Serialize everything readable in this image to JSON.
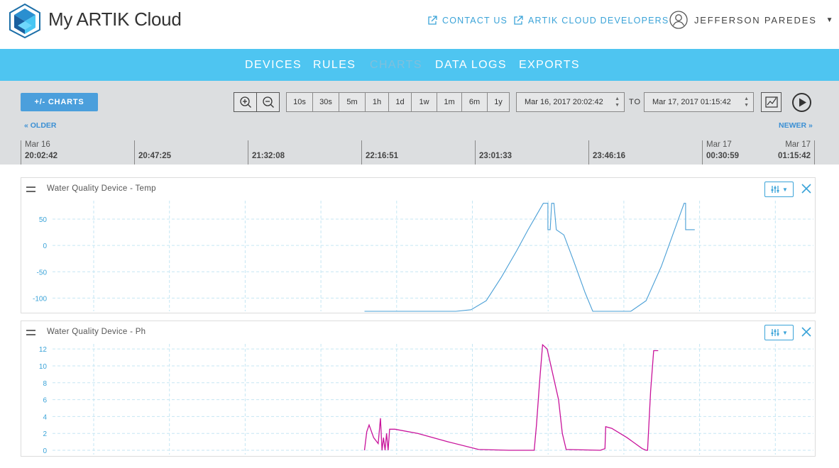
{
  "app": {
    "title": "My ARTIK Cloud"
  },
  "header": {
    "contact_label": "CONTACT US",
    "developers_label": "ARTIK CLOUD DEVELOPERS",
    "user_name": "JEFFERSON PAREDES"
  },
  "nav": {
    "items": [
      {
        "label": "DEVICES"
      },
      {
        "label": "RULES"
      },
      {
        "label": "CHARTS",
        "active": true
      },
      {
        "label": "DATA LOGS"
      },
      {
        "label": "EXPORTS"
      }
    ]
  },
  "toolbar": {
    "charts_button": "+/- CHARTS",
    "ranges": [
      "10s",
      "30s",
      "5m",
      "1h",
      "1d",
      "1w",
      "1m",
      "6m",
      "1y"
    ],
    "from_value": "Mar 16, 2017 20:02:42",
    "to_label": "TO",
    "to_value": "Mar 17, 2017 01:15:42",
    "older_label": "« OLDER",
    "newer_label": "NEWER »"
  },
  "timeline": {
    "ticks": [
      {
        "date": "Mar 16",
        "time": "20:02:42"
      },
      {
        "date": "",
        "time": "20:47:25"
      },
      {
        "date": "",
        "time": "21:32:08"
      },
      {
        "date": "",
        "time": "22:16:51"
      },
      {
        "date": "",
        "time": "23:01:33"
      },
      {
        "date": "",
        "time": "23:46:16"
      },
      {
        "date": "Mar 17",
        "time": "00:30:59"
      },
      {
        "date": "Mar 17",
        "time": "01:15:42"
      }
    ]
  },
  "colors": {
    "accent": "#4ec5f1",
    "temp_line": "#4a9fd6",
    "ph_line": "#c8139b",
    "link": "#3aa3d8"
  },
  "chart_data": [
    {
      "type": "line",
      "title": "Water Quality Device - Temp",
      "yticks": [
        50,
        0,
        -50,
        -100
      ],
      "ylim": [
        -125,
        85
      ],
      "xlim": [
        0,
        100
      ],
      "series": [
        {
          "color": "#4a9fd6",
          "points": [
            [
              41,
              -125
            ],
            [
              53,
              -125
            ],
            [
              55,
              -122
            ],
            [
              57,
              -105
            ],
            [
              59,
              -60
            ],
            [
              61,
              -10
            ],
            [
              62.5,
              30
            ],
            [
              63.5,
              55
            ],
            [
              64.5,
              80
            ],
            [
              65.1,
              80
            ],
            [
              65.1,
              30
            ],
            [
              65.4,
              30
            ],
            [
              65.6,
              80
            ],
            [
              65.9,
              80
            ],
            [
              66.2,
              30
            ],
            [
              67.2,
              20
            ],
            [
              68.5,
              -30
            ],
            [
              70,
              -90
            ],
            [
              71,
              -125
            ],
            [
              76,
              -125
            ],
            [
              78,
              -105
            ],
            [
              80,
              -40
            ],
            [
              81.5,
              20
            ],
            [
              83,
              80
            ],
            [
              83.2,
              80
            ],
            [
              83.2,
              30
            ],
            [
              84.4,
              30
            ]
          ]
        }
      ]
    },
    {
      "type": "line",
      "title": "Water Quality Device - Ph",
      "yticks": [
        12,
        10,
        8,
        6,
        4,
        2,
        0
      ],
      "ylim": [
        -0.5,
        12.6
      ],
      "xlim": [
        0,
        100
      ],
      "series": [
        {
          "color": "#c8139b",
          "points": [
            [
              41,
              0
            ],
            [
              41.3,
              2.2
            ],
            [
              41.6,
              3
            ],
            [
              42.2,
              1.5
            ],
            [
              42.8,
              0.8
            ],
            [
              43.1,
              3.8
            ],
            [
              43.3,
              0
            ],
            [
              43.5,
              1.5
            ],
            [
              43.7,
              0
            ],
            [
              43.9,
              2
            ],
            [
              44.1,
              0
            ],
            [
              44.3,
              2.5
            ],
            [
              45,
              2.5
            ],
            [
              48,
              2
            ],
            [
              52,
              1
            ],
            [
              56,
              0.1
            ],
            [
              60,
              0
            ],
            [
              63,
              0
            ],
            [
              63.3,
              0
            ],
            [
              63.6,
              3
            ],
            [
              64,
              8
            ],
            [
              64.4,
              12.5
            ],
            [
              65,
              12
            ],
            [
              66.5,
              6
            ],
            [
              67,
              2
            ],
            [
              67.5,
              0.1
            ],
            [
              72,
              0
            ],
            [
              72.6,
              0.2
            ],
            [
              72.7,
              2.8
            ],
            [
              73.5,
              2.6
            ],
            [
              75.5,
              1.5
            ],
            [
              77.5,
              0.2
            ],
            [
              78,
              0
            ],
            [
              78.2,
              0
            ],
            [
              78.6,
              7
            ],
            [
              79,
              11.8
            ],
            [
              79.6,
              11.8
            ]
          ]
        }
      ]
    }
  ]
}
